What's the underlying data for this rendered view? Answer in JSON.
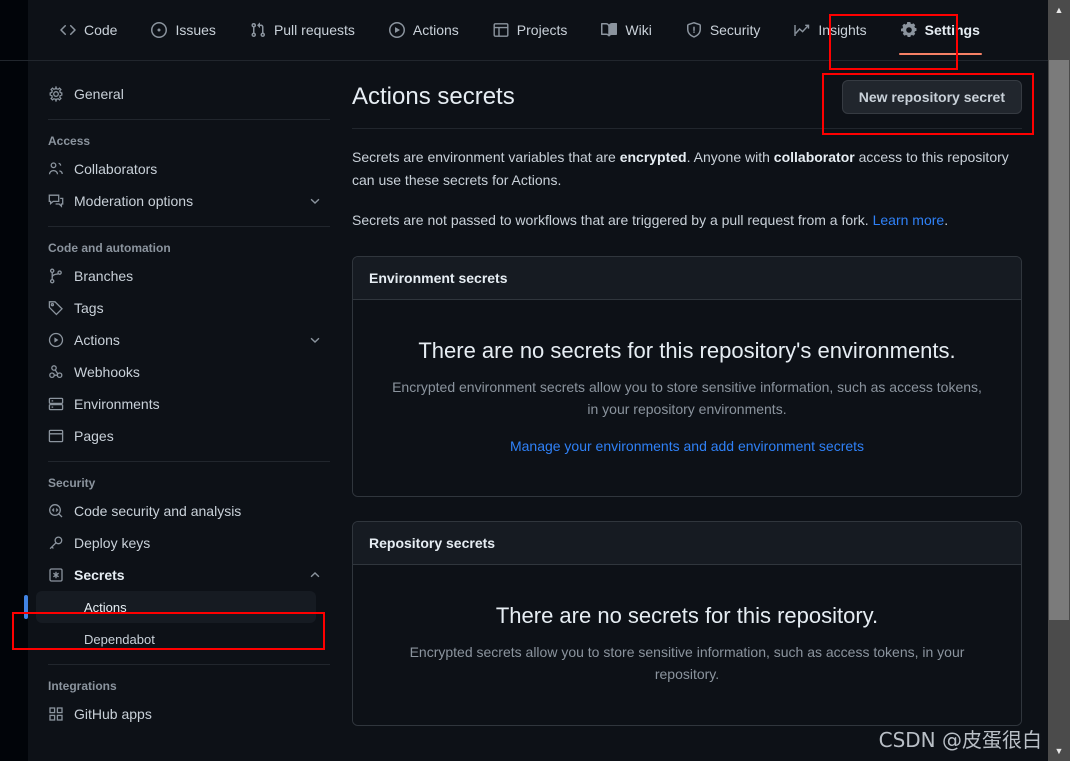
{
  "topnav": {
    "items": [
      {
        "label": "Code",
        "icon": "code-icon",
        "selected": false
      },
      {
        "label": "Issues",
        "icon": "issue-opened-icon",
        "selected": false
      },
      {
        "label": "Pull requests",
        "icon": "git-pull-request-icon",
        "selected": false
      },
      {
        "label": "Actions",
        "icon": "play-icon",
        "selected": false
      },
      {
        "label": "Projects",
        "icon": "table-icon",
        "selected": false
      },
      {
        "label": "Wiki",
        "icon": "book-icon",
        "selected": false
      },
      {
        "label": "Security",
        "icon": "shield-icon",
        "selected": false
      },
      {
        "label": "Insights",
        "icon": "graph-icon",
        "selected": false
      },
      {
        "label": "Settings",
        "icon": "gear-icon",
        "selected": true
      }
    ]
  },
  "sidebar": {
    "general": {
      "label": "General",
      "icon": "gear-icon"
    },
    "groups": [
      {
        "title": "Access",
        "items": [
          {
            "label": "Collaborators",
            "icon": "people-icon",
            "chevron": false
          },
          {
            "label": "Moderation options",
            "icon": "comment-discussion-icon",
            "chevron": "down"
          }
        ]
      },
      {
        "title": "Code and automation",
        "items": [
          {
            "label": "Branches",
            "icon": "git-branch-icon",
            "chevron": false
          },
          {
            "label": "Tags",
            "icon": "tag-icon",
            "chevron": false
          },
          {
            "label": "Actions",
            "icon": "play-icon",
            "chevron": "down"
          },
          {
            "label": "Webhooks",
            "icon": "webhook-icon",
            "chevron": false
          },
          {
            "label": "Environments",
            "icon": "server-icon",
            "chevron": false
          },
          {
            "label": "Pages",
            "icon": "browser-icon",
            "chevron": false
          }
        ]
      },
      {
        "title": "Security",
        "items": [
          {
            "label": "Code security and analysis",
            "icon": "codescan-icon",
            "chevron": false
          },
          {
            "label": "Deploy keys",
            "icon": "key-icon",
            "chevron": false
          },
          {
            "label": "Secrets",
            "icon": "asterisk-key-icon",
            "chevron": "up",
            "bold": true
          }
        ]
      }
    ],
    "secrets_sub": [
      {
        "label": "Actions",
        "active": true
      },
      {
        "label": "Dependabot",
        "active": false
      }
    ],
    "integrations": {
      "title": "Integrations",
      "items": [
        {
          "label": "GitHub apps",
          "icon": "apps-icon",
          "chevron": false
        }
      ]
    }
  },
  "main": {
    "title": "Actions secrets",
    "new_secret_button": "New repository secret",
    "paragraph1_a": "Secrets are environment variables that are ",
    "paragraph1_b": "encrypted",
    "paragraph1_c": ". Anyone with ",
    "paragraph1_d": "collaborator",
    "paragraph1_e": " access to this repository can use these secrets for Actions.",
    "paragraph2_a": "Secrets are not passed to workflows that are triggered by a pull request from a fork. ",
    "paragraph2_link": "Learn more",
    "paragraph2_b": ".",
    "cards": [
      {
        "header": "Environment secrets",
        "blank_title": "There are no secrets for this repository's environments.",
        "blank_desc": "Encrypted environment secrets allow you to store sensitive information, such as access tokens, in your repository environments.",
        "blank_link": "Manage your environments and add environment secrets"
      },
      {
        "header": "Repository secrets",
        "blank_title": "There are no secrets for this repository.",
        "blank_desc": "Encrypted secrets allow you to store sensitive information, such as access tokens, in your repository.",
        "blank_link": ""
      }
    ]
  },
  "watermark": {
    "text": "CSDN @皮蛋很白"
  },
  "colors": {
    "background": "#0d1117",
    "accent_link": "#2f81f7",
    "tab_underline": "#f78166",
    "annotation_red": "#fe0000",
    "active_indicator": "#4184e4",
    "card_header": "#161b22",
    "border": "#30363d"
  },
  "annotations": [
    {
      "name": "settings-tab-highlight"
    },
    {
      "name": "new-repository-secret-highlight"
    },
    {
      "name": "sidebar-actions-highlight"
    }
  ]
}
